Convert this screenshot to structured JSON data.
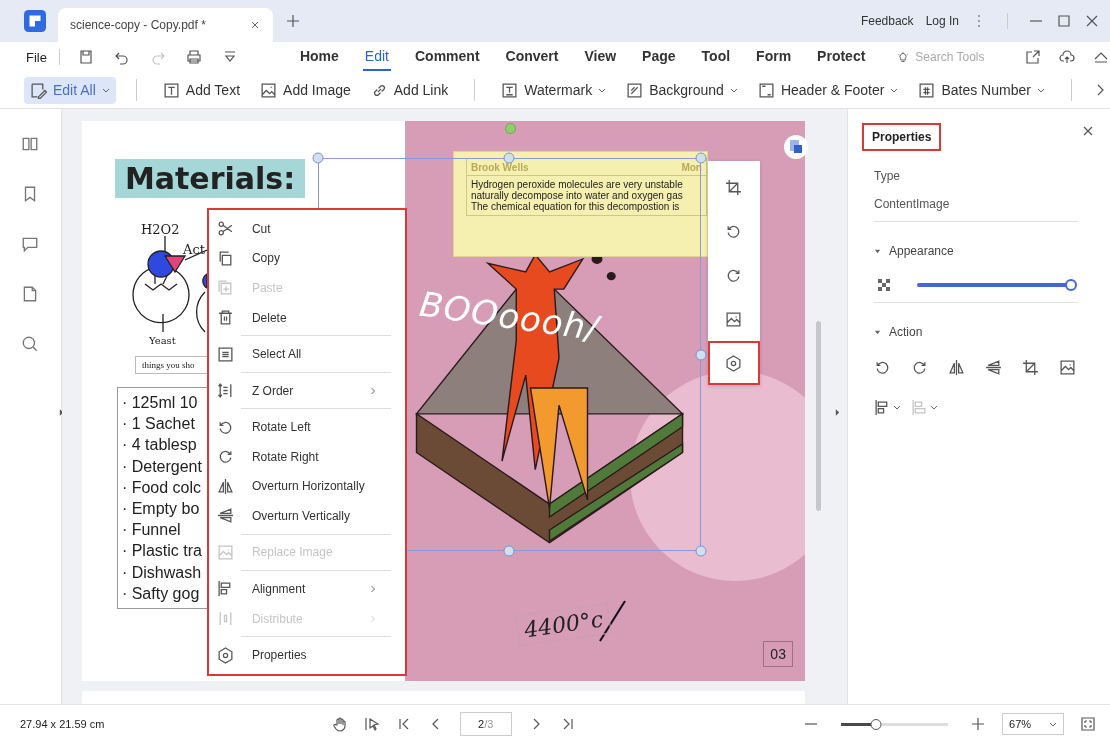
{
  "tab": {
    "title": "science-copy - Copy.pdf *"
  },
  "title_bar": {
    "links": [
      "Feedback",
      "Log In"
    ]
  },
  "menu_bar": {
    "file": "File",
    "quick_tools": [
      {
        "kind": "save",
        "disabled": false
      },
      {
        "kind": "undo",
        "disabled": false
      },
      {
        "kind": "redo",
        "disabled": true
      },
      {
        "kind": "print",
        "disabled": false
      },
      {
        "kind": "more",
        "disabled": false
      }
    ],
    "tabs": [
      {
        "label": "Home",
        "selected": false
      },
      {
        "label": "Edit",
        "selected": true
      },
      {
        "label": "Comment",
        "selected": false
      },
      {
        "label": "Convert",
        "selected": false
      },
      {
        "label": "View",
        "selected": false
      },
      {
        "label": "Page",
        "selected": false
      },
      {
        "label": "Tool",
        "selected": false
      },
      {
        "label": "Form",
        "selected": false
      },
      {
        "label": "Protect",
        "selected": false
      }
    ],
    "search": {
      "placeholder": "Search Tools"
    }
  },
  "toolbar": [
    [
      {
        "kind": "edit_all",
        "label": "Edit All",
        "dropdown": true,
        "selected": true
      }
    ],
    [
      {
        "kind": "add_text",
        "label": "Add Text",
        "dropdown": false,
        "selected": false
      },
      {
        "kind": "add_image",
        "label": "Add Image",
        "dropdown": false,
        "selected": false
      },
      {
        "kind": "link",
        "label": "Add Link",
        "dropdown": false,
        "selected": false
      }
    ],
    [
      {
        "kind": "watermark",
        "label": "Watermark",
        "dropdown": true,
        "selected": false
      },
      {
        "kind": "background",
        "label": "Background",
        "dropdown": true,
        "selected": false
      },
      {
        "kind": "header_footer",
        "label": "Header & Footer",
        "dropdown": true,
        "selected": false
      },
      {
        "kind": "bates",
        "label": "Bates Number",
        "dropdown": true,
        "selected": false
      }
    ]
  ],
  "sidebar": [
    {
      "kind": "pages"
    },
    {
      "kind": "bookmark"
    },
    {
      "kind": "comment"
    },
    {
      "kind": "attachment"
    },
    {
      "kind": "search"
    }
  ],
  "page": {
    "heading": "Materials:",
    "diagram_labels": [
      "H2O2",
      "Act",
      "Yeast"
    ],
    "caption": "things you sho",
    "list": [
      "· 125ml 10",
      "· 1 Sachet",
      "· 4 tablesp",
      "· Detergent",
      "· Food colc",
      "· Empty bo",
      "· Funnel",
      "· Plastic tra",
      "· Dishwash",
      "· Safty gog"
    ],
    "note": {
      "author": "Brook Wells",
      "date": "Mon",
      "lines": [
        "Hydrogen peroxide molecules are very unstable",
        "naturally decompose into water and oxygen gas",
        "The chemical equation for this decompostion is"
      ]
    },
    "exclaim": "BOOoooh/",
    "temperature": "4400°c",
    "page_number": "03"
  },
  "context_menu": [
    {
      "kind": "cut",
      "label": "Cut",
      "disabled": false,
      "submenu": false,
      "divider_after": false
    },
    {
      "kind": "copy",
      "label": "Copy",
      "disabled": false,
      "submenu": false,
      "divider_after": false
    },
    {
      "kind": "paste",
      "label": "Paste",
      "disabled": true,
      "submenu": false,
      "divider_after": false
    },
    {
      "kind": "delete",
      "label": "Delete",
      "disabled": false,
      "submenu": false,
      "divider_after": true
    },
    {
      "kind": "select_all",
      "label": "Select All",
      "disabled": false,
      "submenu": false,
      "divider_after": true
    },
    {
      "kind": "z_order",
      "label": "Z Order",
      "disabled": false,
      "submenu": true,
      "divider_after": true
    },
    {
      "kind": "rotate_left",
      "label": "Rotate Left",
      "disabled": false,
      "submenu": false,
      "divider_after": false
    },
    {
      "kind": "rotate_right",
      "label": "Rotate Right",
      "disabled": false,
      "submenu": false,
      "divider_after": false
    },
    {
      "kind": "flip_h",
      "label": "Overturn Horizontally",
      "disabled": false,
      "submenu": false,
      "divider_after": false
    },
    {
      "kind": "flip_v",
      "label": "Overturn Vertically",
      "disabled": false,
      "submenu": false,
      "divider_after": true
    },
    {
      "kind": "replace",
      "label": "Replace Image",
      "disabled": true,
      "submenu": false,
      "divider_after": true
    },
    {
      "kind": "align",
      "label": "Alignment",
      "disabled": false,
      "submenu": true,
      "divider_after": false
    },
    {
      "kind": "distribute",
      "label": "Distribute",
      "disabled": true,
      "submenu": true,
      "divider_after": true
    },
    {
      "kind": "settings",
      "label": "Properties",
      "disabled": false,
      "submenu": false,
      "divider_after": false
    }
  ],
  "image_toolbar": [
    {
      "kind": "crop",
      "selected": false
    },
    {
      "kind": "rotate_left",
      "selected": false
    },
    {
      "kind": "rotate_right",
      "selected": false
    },
    {
      "kind": "replace",
      "selected": false
    },
    {
      "kind": "settings",
      "selected": true
    }
  ],
  "properties": {
    "title": "Properties",
    "type_label": "Type",
    "type_value": "ContentImage",
    "appearance": {
      "label": "Appearance",
      "expanded": true,
      "opacity": {
        "level": 1
      }
    },
    "action": {
      "label": "Action",
      "expanded": true,
      "tools": [
        {
          "kind": "rotate_left",
          "dropdown": false,
          "disabled": false
        },
        {
          "kind": "rotate_right",
          "dropdown": false,
          "disabled": false
        },
        {
          "kind": "flip_h",
          "dropdown": false,
          "disabled": false
        },
        {
          "kind": "flip_v",
          "dropdown": false,
          "disabled": false
        },
        {
          "kind": "crop",
          "dropdown": false,
          "disabled": false
        },
        {
          "kind": "replace",
          "dropdown": false,
          "disabled": false
        },
        {
          "kind": "align",
          "dropdown": true,
          "disabled": false
        },
        {
          "kind": "distribute_v",
          "dropdown": true,
          "disabled": true
        }
      ]
    }
  },
  "status_bar": {
    "dimensions": "27.94 x 21.59 cm",
    "page": "2",
    "page_total": "/3",
    "zoom_slider": {
      "level": 0.33
    },
    "zoom": "67%"
  }
}
